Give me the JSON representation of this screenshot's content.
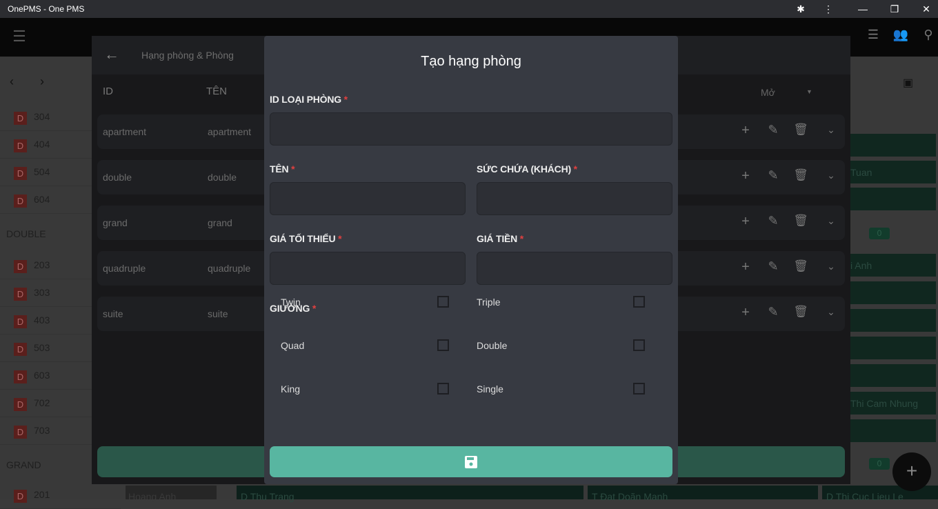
{
  "window": {
    "title": "OnePMS - One PMS"
  },
  "background": {
    "rooms_top": [
      "304",
      "404",
      "504",
      "604"
    ],
    "category_double": "DOUBLE",
    "rooms_double": [
      "203",
      "303",
      "403",
      "503",
      "603",
      "702",
      "703"
    ],
    "category_grand": "GRAND",
    "rooms_grand": [
      "201"
    ],
    "room_status": "D",
    "guest_fragments": [
      "Tuan",
      "i Anh",
      "Thi Cam Nhung"
    ],
    "bottom_bookings": [
      "Hoang Anh",
      "Thu Trang",
      "Đat Doãn Manh",
      "Thi Cuc Lieu Le"
    ],
    "bottom_prefixes": [
      "D",
      "T",
      "D"
    ],
    "badges": [
      "0",
      "0"
    ]
  },
  "panel": {
    "title": "Hạng phòng & Phòng",
    "columns": {
      "id": "ID",
      "name": "TÊN"
    },
    "filter": {
      "value": "Mở"
    },
    "rows": [
      {
        "id": "apartment",
        "name": "apartment"
      },
      {
        "id": "double",
        "name": "double"
      },
      {
        "id": "grand",
        "name": "grand"
      },
      {
        "id": "quadruple",
        "name": "quadruple"
      },
      {
        "id": "suite",
        "name": "suite"
      }
    ]
  },
  "dialog": {
    "title": "Tạo hạng phòng",
    "required_mark": "*",
    "fields": {
      "room_type_id": {
        "label": "ID LOẠI PHÒNG",
        "value": ""
      },
      "name": {
        "label": "TÊN",
        "value": ""
      },
      "capacity": {
        "label": "SỨC CHỨA (KHÁCH)",
        "value": ""
      },
      "min_price": {
        "label": "GIÁ TỐI THIỂU",
        "value": ""
      },
      "price": {
        "label": "GIÁ TIỀN",
        "value": ""
      }
    },
    "beds": {
      "label": "GIƯỜNG",
      "options": [
        {
          "label": "Twin",
          "checked": false
        },
        {
          "label": "Triple",
          "checked": false
        },
        {
          "label": "Quad",
          "checked": false
        },
        {
          "label": "Double",
          "checked": false
        },
        {
          "label": "King",
          "checked": false
        },
        {
          "label": "Single",
          "checked": false
        }
      ]
    }
  },
  "colors": {
    "accent": "#58b6a1",
    "required": "#e04040",
    "dialog_bg": "#373a42"
  }
}
